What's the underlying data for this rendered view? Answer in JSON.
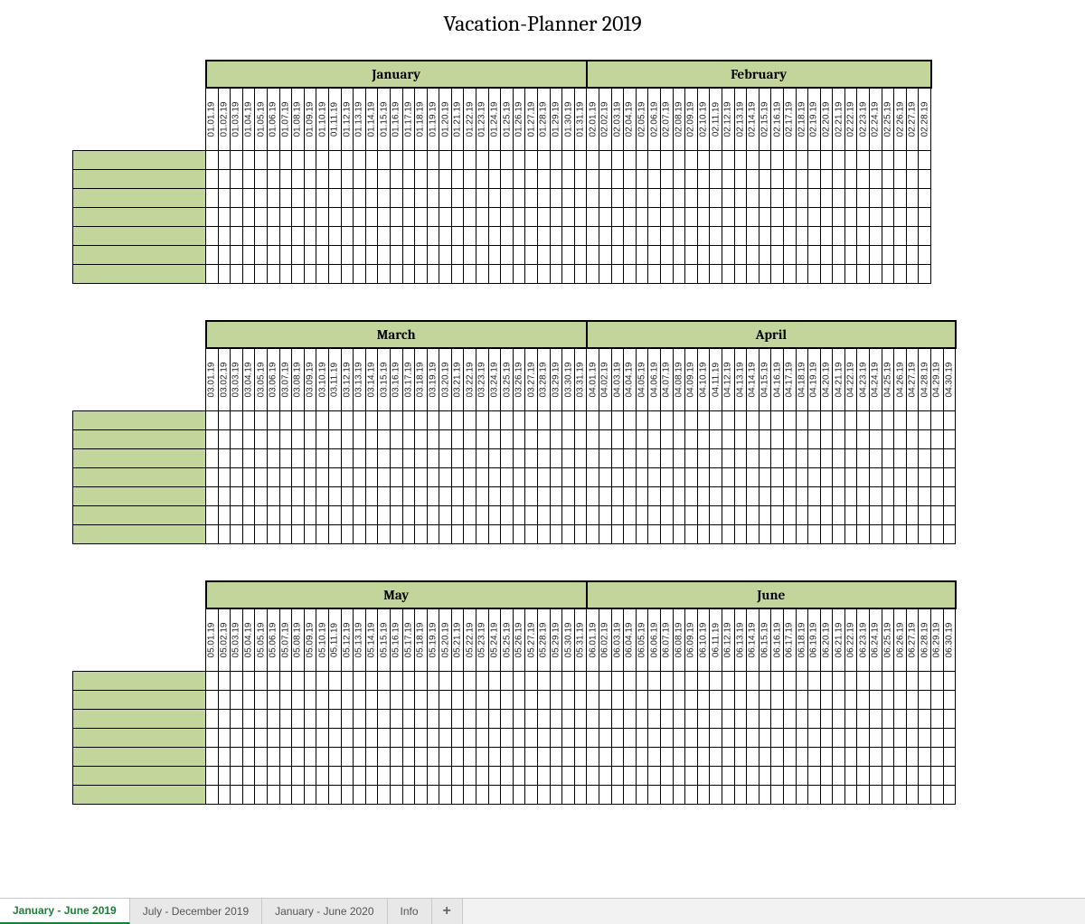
{
  "title": "Vacation-Planner 2019",
  "employee_rows": 7,
  "blocks": [
    {
      "months": [
        {
          "name": "January",
          "prefix": "01",
          "days": 31
        },
        {
          "name": "February",
          "prefix": "02",
          "days": 28
        }
      ]
    },
    {
      "months": [
        {
          "name": "March",
          "prefix": "03",
          "days": 31
        },
        {
          "name": "April",
          "prefix": "04",
          "days": 30
        }
      ]
    },
    {
      "months": [
        {
          "name": "May",
          "prefix": "05",
          "days": 31
        },
        {
          "name": "June",
          "prefix": "06",
          "days": 30
        }
      ]
    }
  ],
  "year_suffix": "19",
  "tabs": [
    {
      "label": "January - June 2019",
      "active": true
    },
    {
      "label": "July - December 2019",
      "active": false
    },
    {
      "label": "January - June 2020",
      "active": false
    },
    {
      "label": "Info",
      "active": false
    }
  ],
  "add_tab_label": "+"
}
